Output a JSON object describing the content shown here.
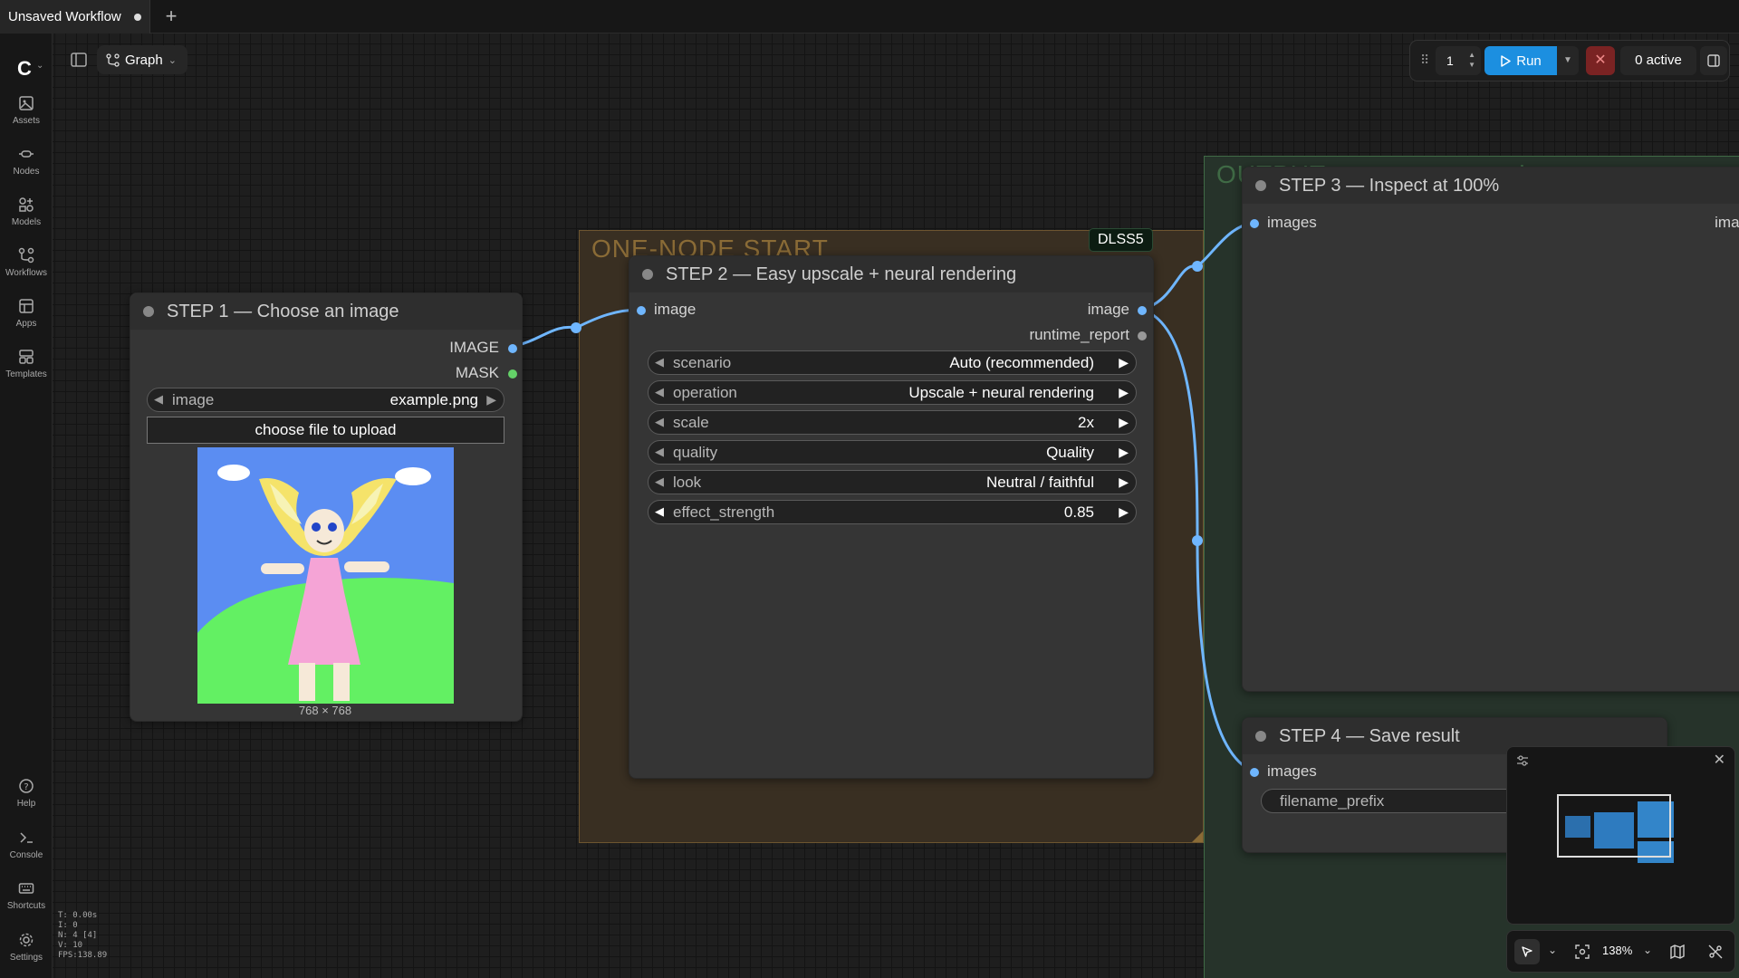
{
  "tab": {
    "title": "Unsaved Workflow",
    "new_tab": "+"
  },
  "sidebar": {
    "items": [
      {
        "label": "Assets"
      },
      {
        "label": "Nodes"
      },
      {
        "label": "Models"
      },
      {
        "label": "Workflows"
      },
      {
        "label": "Apps"
      },
      {
        "label": "Templates"
      }
    ],
    "bottom": [
      {
        "label": "Help"
      },
      {
        "label": "Console"
      },
      {
        "label": "Shortcuts"
      },
      {
        "label": "Settings"
      }
    ]
  },
  "stats": [
    "T: 0.00s",
    "I: 0",
    "N: 4 [4]",
    "V: 10",
    "FPS:138.89"
  ],
  "view_mode": "Graph",
  "toolbar": {
    "queue_count": "1",
    "run_label": "Run",
    "active_label": "0 active"
  },
  "groups": [
    {
      "title": "ONE-NODE START"
    },
    {
      "title": "OUTPUT — compare and save"
    }
  ],
  "badge": "DLSS5",
  "nodes": {
    "step1": {
      "title": "STEP 1 — Choose an image",
      "outputs": [
        "IMAGE",
        "MASK"
      ],
      "image_widget": {
        "name": "image",
        "value": "example.png"
      },
      "upload_label": "choose file to upload",
      "caption": "768 × 768"
    },
    "step2": {
      "title": "STEP 2 — Easy upscale + neural rendering",
      "input": "image",
      "outputs": [
        "image",
        "runtime_report"
      ],
      "widgets": [
        {
          "name": "scenario",
          "value": "Auto (recommended)"
        },
        {
          "name": "operation",
          "value": "Upscale + neural rendering"
        },
        {
          "name": "scale",
          "value": "2x"
        },
        {
          "name": "quality",
          "value": "Quality"
        },
        {
          "name": "look",
          "value": "Neutral / faithful"
        },
        {
          "name": "effect_strength",
          "value": "0.85"
        }
      ]
    },
    "step3": {
      "title": "STEP 3 — Inspect at 100%",
      "input": "images",
      "output_partial": "imag"
    },
    "step4": {
      "title": "STEP 4 — Save result",
      "input": "images",
      "widget_name": "filename_prefix"
    }
  },
  "zoom": "138%",
  "colors": {
    "link": "#6fb6ff",
    "run": "#1c8fe0",
    "group_start": "#392f22",
    "group_output": "#26332a"
  },
  "icons": {
    "assets": "image-icon",
    "nodes": "plug-icon",
    "models": "shapes-icon",
    "workflows": "flow-icon",
    "apps": "grid-icon",
    "templates": "layers-icon",
    "help": "question-icon",
    "console": "terminal-icon",
    "shortcuts": "keyboard-icon",
    "settings": "gear-icon"
  }
}
